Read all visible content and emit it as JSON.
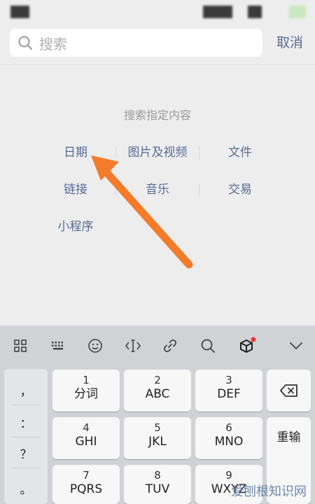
{
  "search": {
    "placeholder": "搜索",
    "cancel_label": "取消"
  },
  "content": {
    "hint": "搜索指定内容",
    "options": [
      "日期",
      "图片及视频",
      "文件",
      "链接",
      "音乐",
      "交易",
      "小程序"
    ]
  },
  "toolbar": {
    "icons": [
      "grid-icon",
      "keyboard-icon",
      "emoji-icon",
      "cursor-icon",
      "link-icon",
      "search-icon",
      "cube-icon",
      "collapse-icon"
    ]
  },
  "keyboard": {
    "symbols": [
      "，",
      "：",
      "？",
      "。"
    ],
    "keys": [
      {
        "num": "1",
        "label": "分词"
      },
      {
        "num": "2",
        "label": "ABC"
      },
      {
        "num": "3",
        "label": "DEF"
      },
      {
        "num": "4",
        "label": "GHI"
      },
      {
        "num": "5",
        "label": "JKL"
      },
      {
        "num": "6",
        "label": "MNO"
      },
      {
        "num": "7",
        "label": "PQRS"
      },
      {
        "num": "8",
        "label": "TUV"
      },
      {
        "num": "9",
        "label": "WXYZ"
      }
    ],
    "reinput_label": "重输"
  },
  "watermark": "爱刨根知识网",
  "colors": {
    "accent": "#576b95",
    "arrow": "#f47b2a",
    "badge": "#e53935"
  }
}
